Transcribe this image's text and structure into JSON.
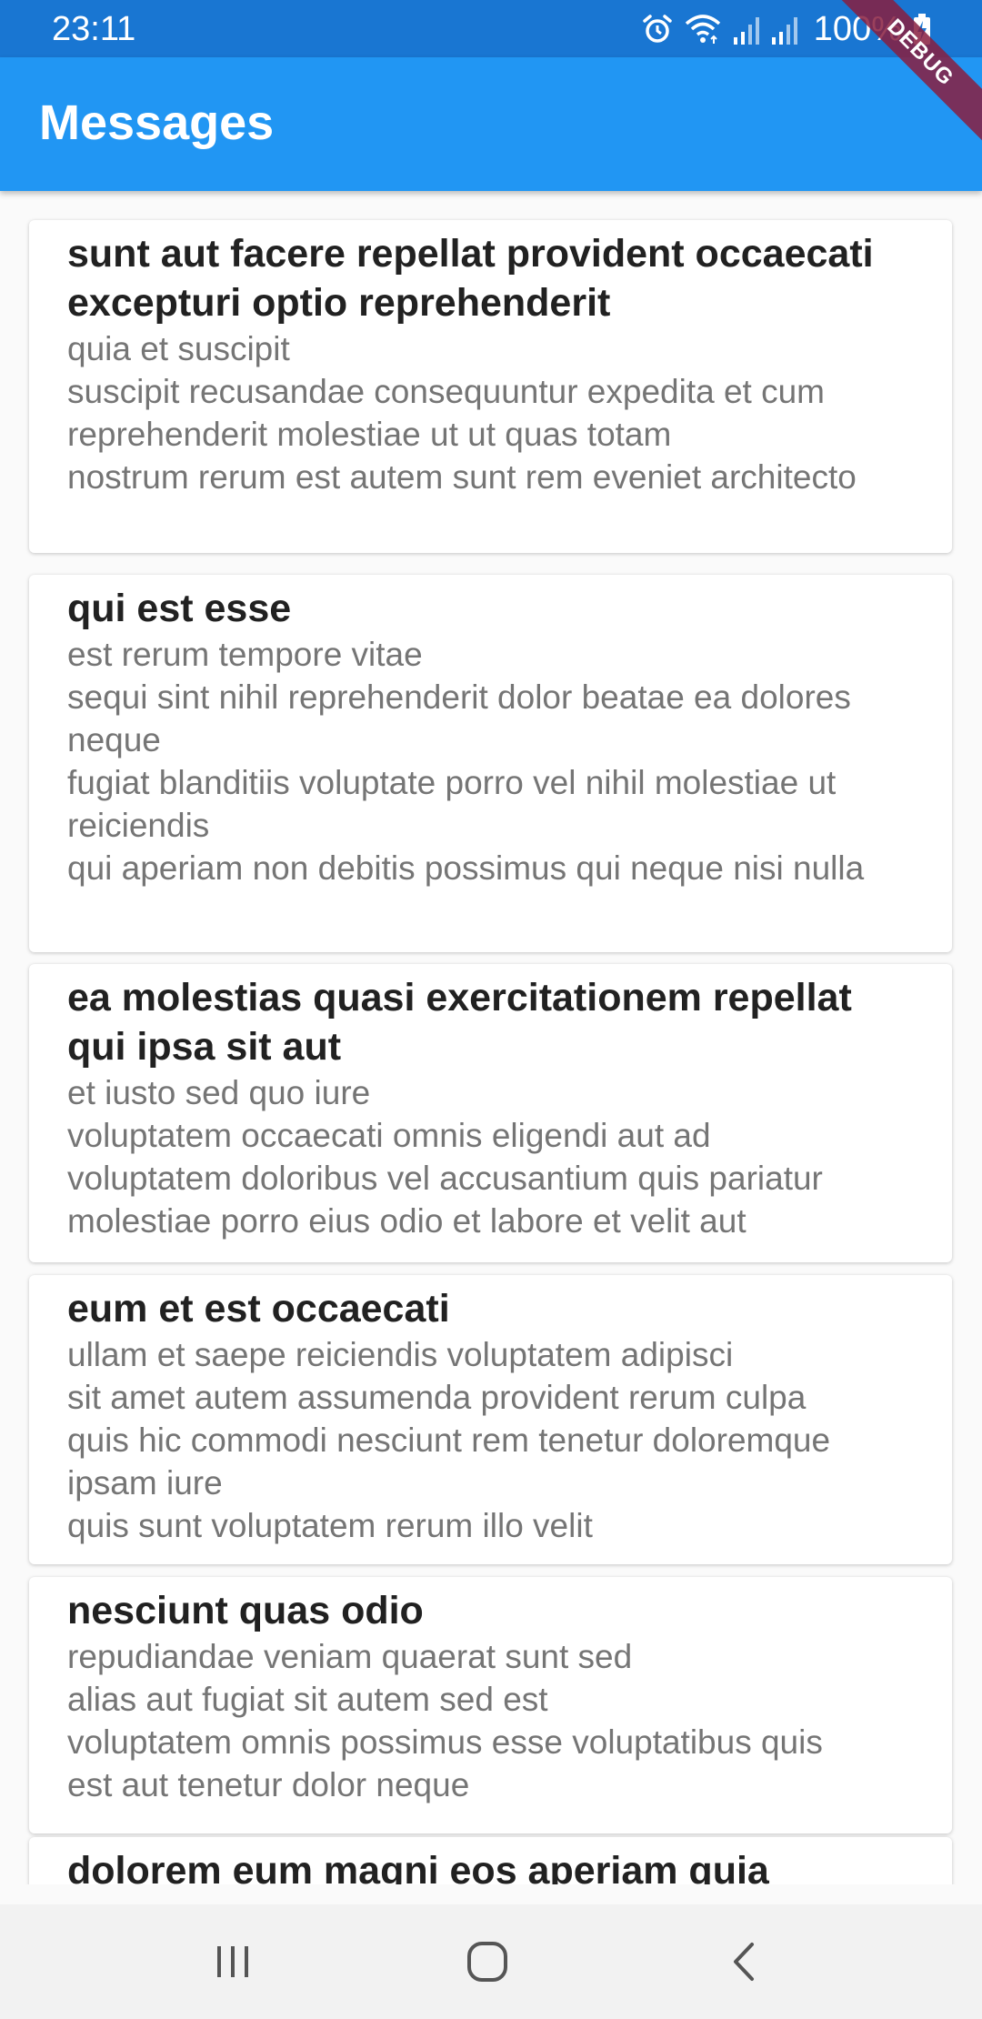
{
  "status_bar": {
    "time": "23:11",
    "battery": "100%",
    "icons": [
      "alarm-icon",
      "wifi-icon",
      "signal-icon",
      "signal-icon",
      "battery-charging-icon"
    ]
  },
  "app_bar": {
    "title": "Messages",
    "color": "#2196f3"
  },
  "debug_banner": "DEBUG",
  "messages": [
    {
      "title": "sunt aut facere repellat provident occaecati excepturi optio reprehenderit",
      "body": "quia et suscipit\nsuscipit recusandae consequuntur expedita et cum reprehenderit molestiae ut ut quas totam\nnostrum rerum est autem sunt rem eveniet architecto"
    },
    {
      "title": "qui est esse",
      "body": "est rerum tempore vitae\nsequi sint nihil reprehenderit dolor beatae ea dolores neque\nfugiat blanditiis voluptate porro vel nihil molestiae ut reiciendis\nqui aperiam non debitis possimus qui neque nisi nulla"
    },
    {
      "title": "ea molestias quasi exercitationem repellat qui ipsa sit aut",
      "body": "et iusto sed quo iure\nvoluptatem occaecati omnis eligendi aut ad\nvoluptatem doloribus vel accusantium quis pariatur\nmolestiae porro eius odio et labore et velit aut"
    },
    {
      "title": "eum et est occaecati",
      "body": "ullam et saepe reiciendis voluptatem adipisci\nsit amet autem assumenda provident rerum culpa\nquis hic commodi nesciunt rem tenetur doloremque ipsam iure\nquis sunt voluptatem rerum illo velit"
    },
    {
      "title": "nesciunt quas odio",
      "body": "repudiandae veniam quaerat sunt sed\nalias aut fugiat sit autem sed est\nvoluptatem omnis possimus esse voluptatibus quis\nest aut tenetur dolor neque"
    },
    {
      "title": "dolorem eum magni eos aperiam quia",
      "body": ""
    }
  ],
  "nav_bar": {
    "buttons": [
      "recent-apps-icon",
      "home-icon",
      "back-icon"
    ]
  }
}
